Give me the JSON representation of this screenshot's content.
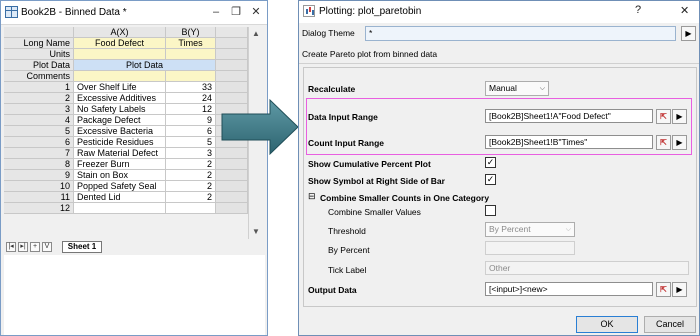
{
  "workbook": {
    "title": "Book2B - Binned Data *",
    "columns": [
      "A(X)",
      "B(Y)"
    ],
    "label_rows": [
      {
        "label": "Long Name",
        "a": "Food Defect",
        "b": "Times"
      },
      {
        "label": "Units",
        "a": "",
        "b": ""
      },
      {
        "label": "Plot Data",
        "a": "Plot Data",
        "b": ""
      },
      {
        "label": "Comments",
        "a": "",
        "b": ""
      }
    ],
    "rows": [
      {
        "n": "1",
        "a": "Over Shelf Life",
        "b": "33"
      },
      {
        "n": "2",
        "a": "Excessive Additives",
        "b": "24"
      },
      {
        "n": "3",
        "a": "No Safety Labels",
        "b": "12"
      },
      {
        "n": "4",
        "a": "Package Defect",
        "b": "9"
      },
      {
        "n": "5",
        "a": "Excessive Bacteria",
        "b": "6"
      },
      {
        "n": "6",
        "a": "Pesticide Residues",
        "b": "5"
      },
      {
        "n": "7",
        "a": "Raw Material Defect",
        "b": "3"
      },
      {
        "n": "8",
        "a": "Freezer Burn",
        "b": "2"
      },
      {
        "n": "9",
        "a": "Stain on Box",
        "b": "2"
      },
      {
        "n": "10",
        "a": "Popped Safety Seal",
        "b": "2"
      },
      {
        "n": "11",
        "a": "Dented Lid",
        "b": "2"
      },
      {
        "n": "12",
        "a": "",
        "b": ""
      }
    ],
    "sheet_tab": "Sheet 1",
    "nav_buttons": [
      "|◂",
      "▸|",
      "+",
      "V"
    ]
  },
  "dialog": {
    "title": "Plotting: plot_paretobin",
    "help": "?",
    "close": "✕",
    "theme_label": "Dialog Theme",
    "theme_value": "*",
    "theme_arrow": "▶",
    "description": "Create Pareto plot from binned data",
    "recalculate_label": "Recalculate",
    "recalculate_value": "Manual",
    "data_input_label": "Data Input Range",
    "data_input_value": "[Book2B]Sheet1!A\"Food Defect\"",
    "count_input_label": "Count Input Range",
    "count_input_value": "[Book2B]Sheet1!B\"Times\"",
    "show_cumulative_label": "Show Cumulative Percent Plot",
    "show_cumulative_checked": true,
    "show_symbol_label": "Show Symbol at Right Side of Bar",
    "show_symbol_checked": true,
    "combine_group_label": "Combine Smaller Counts in One Category",
    "combine_group_toggle": "⊟",
    "combine_values_label": "Combine Smaller Values",
    "combine_values_checked": false,
    "threshold_label": "Threshold",
    "threshold_value": "By Percent",
    "by_percent_label": "By Percent",
    "by_percent_value": "",
    "tick_label_label": "Tick Label",
    "tick_label_value": "Other",
    "output_label": "Output Data",
    "output_value": "[<input>]<new>",
    "ok": "OK",
    "cancel": "Cancel"
  }
}
